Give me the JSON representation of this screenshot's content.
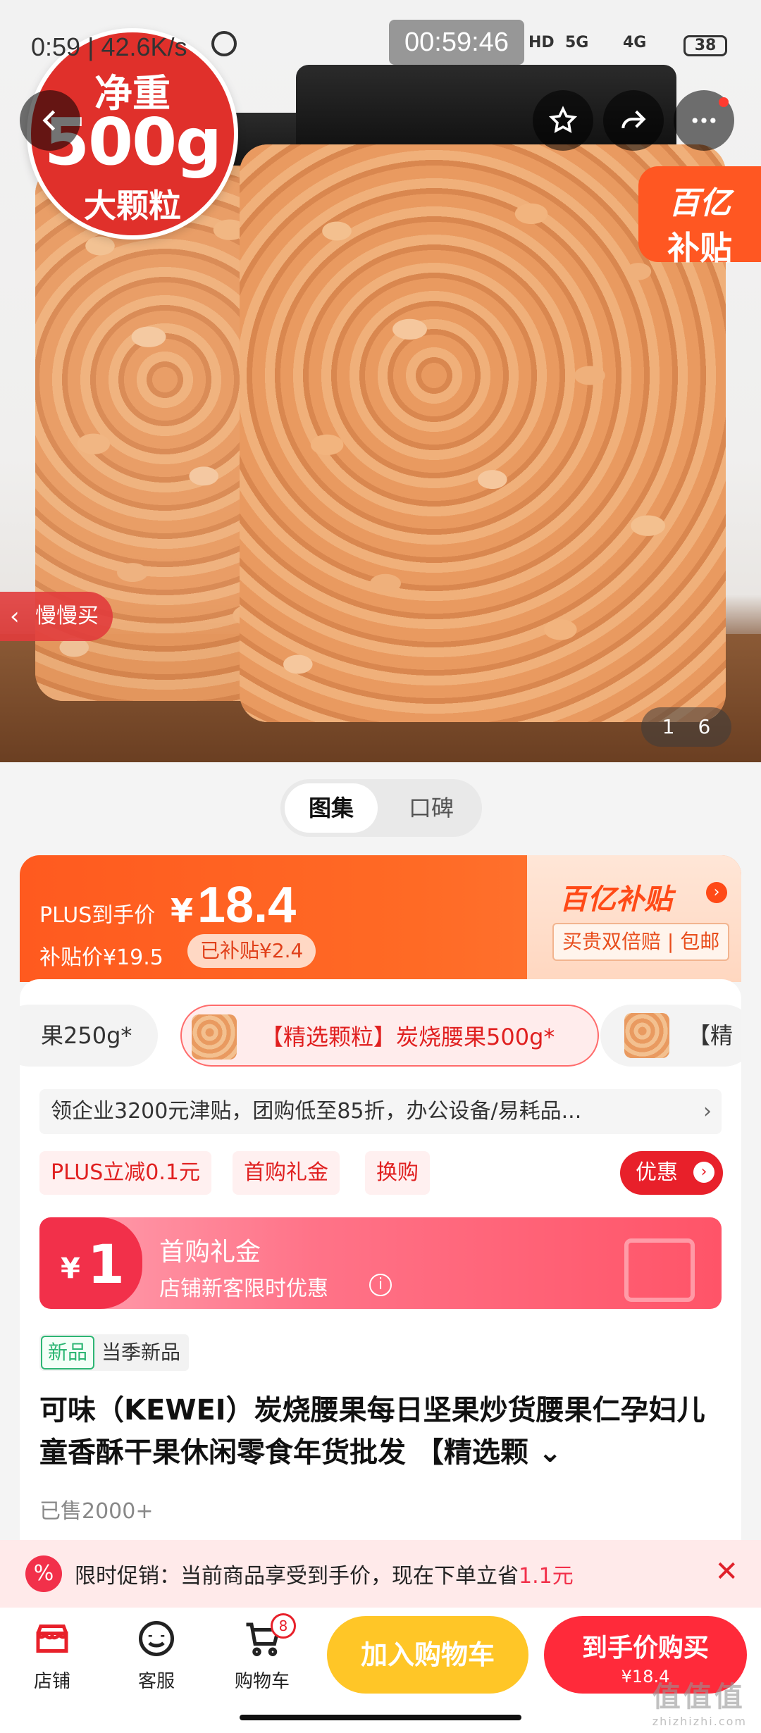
{
  "status_bar": {
    "time": "0:59",
    "net_speed": "42.6K/s",
    "recording_timer": "00:59:46",
    "hd": "HD",
    "sig1": "5G",
    "sig2": "4G",
    "battery": "38"
  },
  "hero": {
    "weight_line1": "净重",
    "weight_line2": "500g",
    "weight_line3": "大颗粒",
    "subsidy_tag_line1": "百亿",
    "subsidy_tag_line2": "补贴",
    "slow_buy": "慢慢买",
    "image_index": "1 6"
  },
  "tabs": {
    "gallery": "图集",
    "reviews": "口碑"
  },
  "price": {
    "plus_label": "PLUS到手价",
    "currency": "¥",
    "plus_price": "18.4",
    "subsidy_price": "补贴价¥19.5",
    "already_subsidy": "已补贴¥2.4",
    "brand": "百亿补贴",
    "guarantee": "买贵双倍赔 | 包邮"
  },
  "sku": {
    "left": "果250g*",
    "selected": "【精选颗粒】炭烧腰果500g*",
    "right": "【精"
  },
  "notice": "领企业3200元津贴，团购低至85折，办公设备/易耗品...",
  "chips": [
    "PLUS立减0.1元",
    "首购礼金",
    "换购"
  ],
  "promo_button": "优惠",
  "coupon": {
    "yen": "¥",
    "amount": "1",
    "title": "首购礼金",
    "subtitle": "店铺新客限时优惠"
  },
  "new_tag": {
    "green": "新品",
    "text": "当季新品"
  },
  "product_title": "可味（KEWEI）炭烧腰果每日坚果炒货腰果仁孕妇儿童香酥干果休闲零食年货批发 【精选颗",
  "sold": "已售2000+",
  "promo_banner": {
    "icon": "%",
    "text_prefix": "限时促销：当前商品享受到手价，现在下单立省",
    "saving": "1.1元"
  },
  "bottom_bar": {
    "shop": "店铺",
    "service": "客服",
    "cart": "购物车",
    "cart_count": "8",
    "add_to_cart": "加入购物车",
    "buy_label": "到手价购买",
    "buy_price": "¥18.4"
  },
  "watermark": {
    "main": "值值值",
    "sub": "zhizhizhi.com"
  },
  "colors": {
    "accent_red": "#ff2a3a",
    "subsidy_orange": "#ff5a1f",
    "cart_yellow": "#ffc627"
  }
}
